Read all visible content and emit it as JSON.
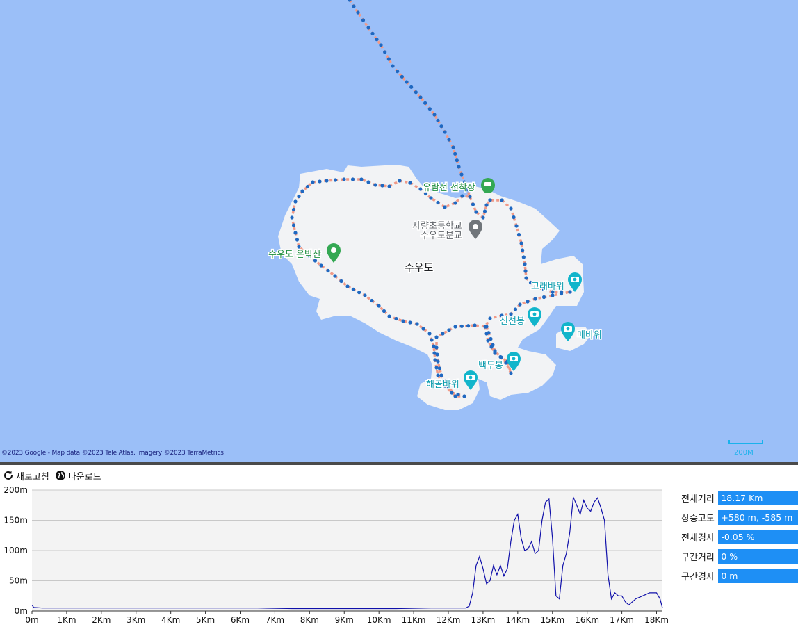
{
  "map": {
    "island_label": "수우도",
    "pois": [
      {
        "label": "유람선 선착장",
        "icon": "ferry-icon",
        "color": "#34a853"
      },
      {
        "label": "사량초등학교\n수우도분교",
        "icon": "school-pin-icon",
        "color": "#70757a"
      },
      {
        "label": "수우도 은박산",
        "icon": "park-pin-icon",
        "color": "#34a853"
      },
      {
        "label": "고래바위",
        "icon": "camera-pin-icon",
        "color": "#12b5cb"
      },
      {
        "label": "신선봉",
        "icon": "camera-pin-icon",
        "color": "#12b5cb"
      },
      {
        "label": "매바위",
        "icon": "camera-pin-icon",
        "color": "#12b5cb"
      },
      {
        "label": "백두봉",
        "icon": "camera-pin-icon",
        "color": "#12b5cb"
      },
      {
        "label": "해골바위",
        "icon": "camera-pin-icon",
        "color": "#12b5cb"
      }
    ],
    "attribution": "©2023 Google - Map data ©2023 Tele Atlas, Imagery ©2023 TerraMetrics",
    "scale_label": "200M",
    "colors": {
      "water": "#9bbff8",
      "land": "#f2f3f5",
      "track_dot": "#1f68c1",
      "track_line": "#f09a88"
    }
  },
  "toolbar": {
    "refresh_label": "새로고침",
    "download_label": "다운로드"
  },
  "stats": {
    "total_distance_label": "전체거리",
    "total_distance_value": "18.17 Km",
    "elevation_gain_label": "상승고도",
    "elevation_gain_value": "+580 m, -585 m",
    "total_slope_label": "전체경사",
    "total_slope_value": "-0.05 %",
    "segment_distance_label": "구간거리",
    "segment_distance_value": "0 %",
    "segment_slope_label": "구간경사",
    "segment_slope_value": "0 m"
  },
  "chart_data": {
    "type": "line",
    "xlabel": "",
    "ylabel": "",
    "x_ticks": [
      "0m",
      "1Km",
      "2Km",
      "3Km",
      "4Km",
      "5Km",
      "6Km",
      "7Km",
      "8Km",
      "9Km",
      "10Km",
      "11Km",
      "12Km",
      "13Km",
      "14Km",
      "15Km",
      "16Km",
      "17Km",
      "18Km"
    ],
    "y_ticks": [
      "0m",
      "50m",
      "100m",
      "150m",
      "200m"
    ],
    "xlim": [
      0,
      18.17
    ],
    "ylim": [
      0,
      200
    ],
    "grid": true,
    "line_color": "#1010aa",
    "series": [
      {
        "x": [
          0,
          0.05,
          0.3,
          0.8,
          1.5,
          2.5,
          3.5,
          4.5,
          5.5,
          6.5,
          7.5,
          8.5,
          9.5,
          10.5,
          11.5,
          12.3,
          12.5,
          12.6,
          12.7,
          12.8,
          12.9,
          13.0,
          13.1,
          13.2,
          13.3,
          13.4,
          13.5,
          13.6,
          13.7,
          13.8,
          13.9,
          14.0,
          14.1,
          14.2,
          14.3,
          14.4,
          14.5,
          14.6,
          14.7,
          14.8,
          14.9,
          15.0,
          15.1,
          15.2,
          15.3,
          15.4,
          15.5,
          15.6,
          15.7,
          15.8,
          15.9,
          16.0,
          16.1,
          16.2,
          16.3,
          16.4,
          16.5,
          16.6,
          16.7,
          16.8,
          16.9,
          17.0,
          17.1,
          17.2,
          17.4,
          17.6,
          17.8,
          18.0,
          18.1,
          18.17
        ],
        "y": [
          10,
          6,
          5,
          5,
          5,
          5,
          5,
          5,
          5,
          5,
          4,
          4,
          4,
          4,
          5,
          5,
          5,
          8,
          30,
          75,
          90,
          70,
          45,
          50,
          75,
          60,
          75,
          58,
          70,
          115,
          150,
          160,
          120,
          100,
          103,
          115,
          95,
          100,
          150,
          180,
          185,
          120,
          25,
          20,
          75,
          95,
          130,
          188,
          175,
          160,
          183,
          170,
          165,
          180,
          187,
          170,
          150,
          60,
          20,
          30,
          25,
          25,
          15,
          10,
          20,
          25,
          30,
          30,
          20,
          5
        ]
      }
    ]
  }
}
